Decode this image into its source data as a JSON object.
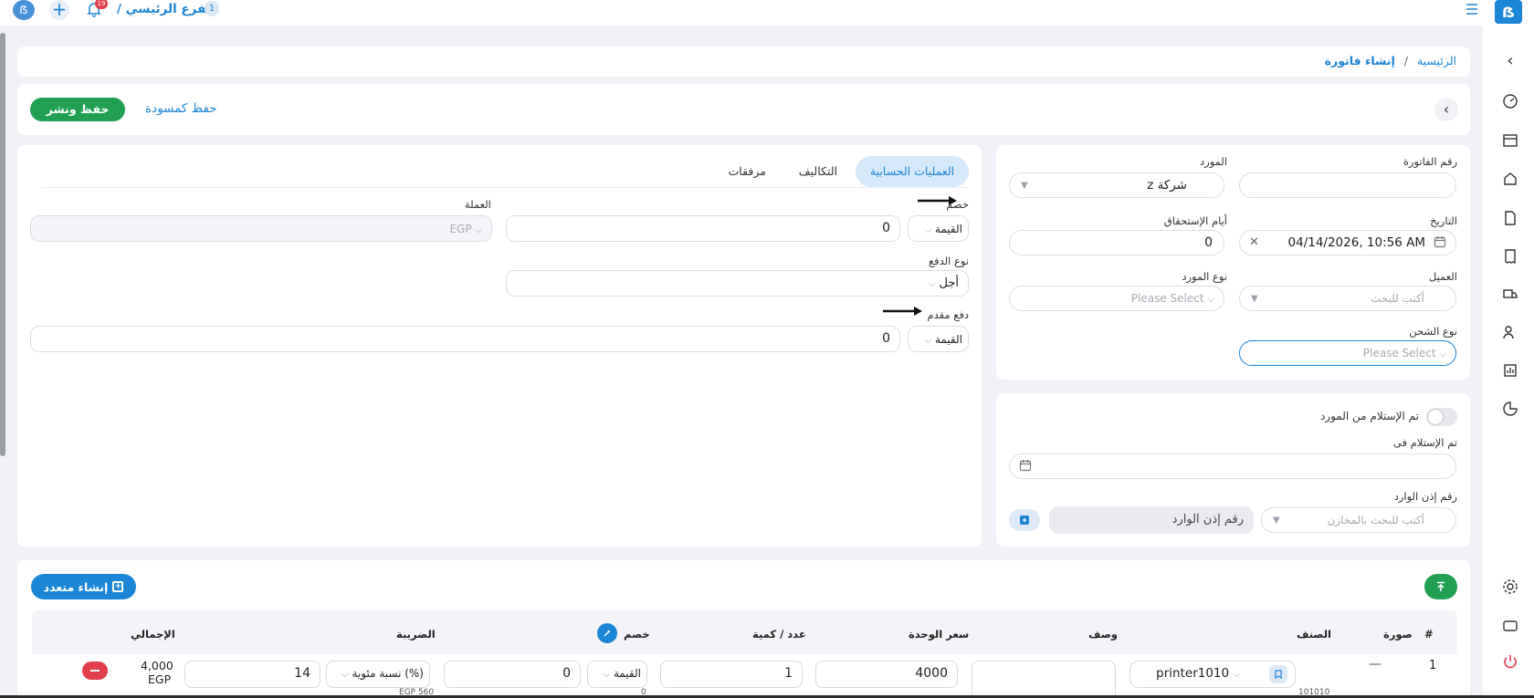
{
  "topbar": {
    "branch_label": "الفرع الرئيسي /",
    "branch_count": "1",
    "notif_count": "19"
  },
  "breadcrumb": {
    "home": "الرئيسية",
    "sep": "/",
    "current": "إنشاء فاتورة"
  },
  "actions": {
    "save_publish": "حفظ ونشر",
    "save_draft": "حفظ كمسودة"
  },
  "invoice": {
    "invoice_number_label": "رقم الفاتورة",
    "invoice_number_value": "",
    "supplier_label": "المورد",
    "supplier_value": "شركة z",
    "date_label": "التاريخ",
    "date_value": "04/14/2026, 10:56 AM",
    "due_days_label": "أيام الإستحقاق",
    "due_days_value": "0",
    "client_label": "العميل",
    "client_placeholder": "أكتب للبحث",
    "supplier_type_label": "نوع المورد",
    "supplier_type_placeholder": "Please Select",
    "shipping_type_label": "نوع الشحن",
    "shipping_type_placeholder": "Please Select"
  },
  "receipt": {
    "received_toggle_label": "تم الإستلام من المورد",
    "received_in_label": "تم الإستلام فى",
    "received_in_value": "",
    "inbound_permit_label": "رقم إذن الوارد",
    "warehouse_search_placeholder": "أكتب للبحث بالمخازن",
    "inbound_permit_placeholder": "رقم إذن الوارد"
  },
  "tabs": [
    {
      "label": "العمليات الحسابية",
      "active": true
    },
    {
      "label": "التكاليف",
      "active": false
    },
    {
      "label": "مرفقات",
      "active": false
    }
  ],
  "calc": {
    "discount_label": "خصم",
    "discount_type": "القيمة",
    "discount_value": "0",
    "currency_label": "العملة",
    "currency_value": "EGP",
    "payment_type_label": "نوع الدفع",
    "payment_type_value": "أجل",
    "advance_payment_label": "دفع مقدم",
    "advance_payment_type": "القيمة",
    "advance_payment_value": "0"
  },
  "items": {
    "create_multiple_label": "إنشاء متعدد",
    "columns": [
      "#",
      "صورة",
      "الصنف",
      "وصف",
      "سعر الوحدة",
      "عدد / كمية",
      "خصم",
      "الضريبة",
      "الإجمالي"
    ],
    "rows": [
      {
        "index": "1",
        "image": "—",
        "item": "printer1010",
        "item_code": "101010",
        "description": "",
        "unit_price": "4000",
        "quantity": "1",
        "discount_type": "القيمة",
        "discount_value": "0",
        "discount_sub": "0",
        "tax_type": "نسبة مئوية (%)",
        "tax_value": "14",
        "tax_sub": "EGP 560",
        "total_amount": "4,000",
        "total_currency": "EGP"
      }
    ]
  },
  "colors": {
    "primary": "#1c86d6",
    "success": "#22a052",
    "danger": "#e23d4b",
    "tab_active_bg": "#d6e9fa"
  },
  "icons": [
    "menu-icon",
    "app-logo-icon",
    "bell-icon",
    "plus-icon",
    "chevron-left-icon",
    "calendar-icon",
    "arrow-up-icon",
    "settings-icon",
    "power-icon"
  ]
}
